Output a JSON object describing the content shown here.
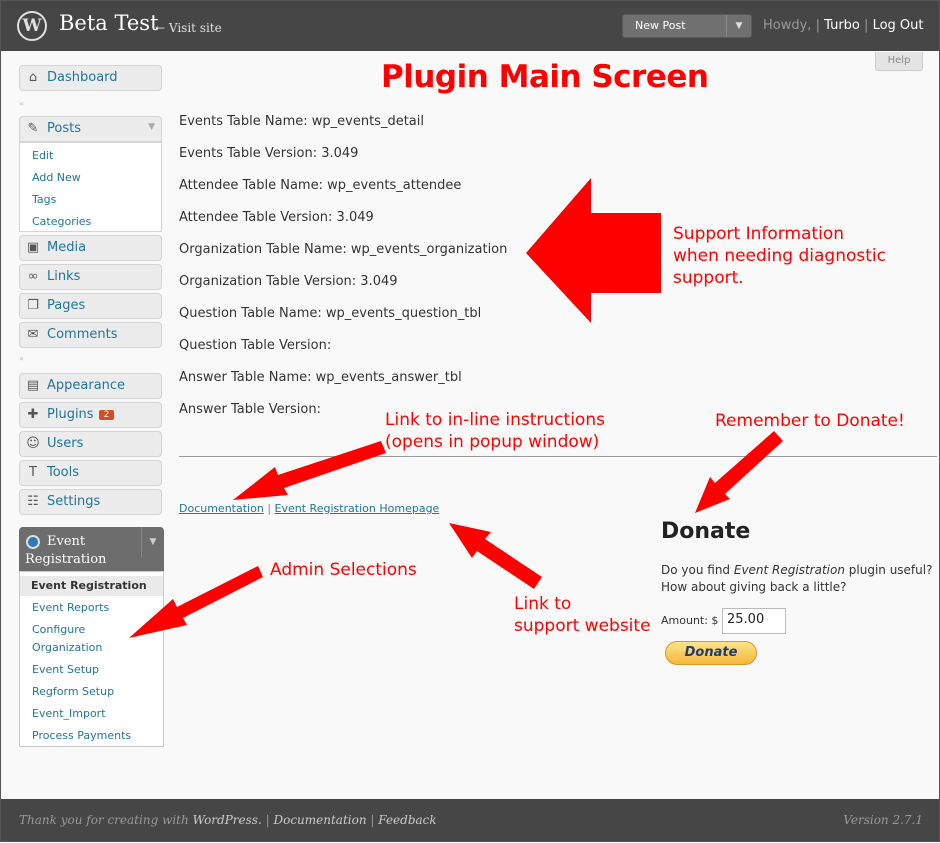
{
  "header": {
    "site_title": "Beta Test",
    "visit_site": "← Visit site",
    "new_post": "New Post",
    "howdy": "Howdy,",
    "separator": "|",
    "user": "Turbo",
    "logout": "Log Out",
    "help": "Help"
  },
  "sidebar": {
    "dashboard": "Dashboard",
    "posts": "Posts",
    "posts_sub": [
      "Edit",
      "Add New",
      "Tags",
      "Categories"
    ],
    "media": "Media",
    "links": "Links",
    "pages": "Pages",
    "comments": "Comments",
    "appearance": "Appearance",
    "plugins": "Plugins",
    "plugins_badge": "2",
    "users": "Users",
    "tools": "Tools",
    "settings": "Settings",
    "event_registration": "Event Registration",
    "event_sub": [
      "Event Registration",
      "Event Reports",
      "Configure",
      "Organization",
      "Event Setup",
      "Regform Setup",
      "Event_Import",
      "Process Payments"
    ]
  },
  "main": {
    "title": "Plugin Main Screen",
    "info": [
      "Events Table Name: wp_events_detail",
      "Events Table Version: 3.049",
      "Attendee Table Name: wp_events_attendee",
      "Attendee Table Version: 3.049",
      "Organization Table Name: wp_events_organization",
      "Organization Table Version: 3.049",
      "Question Table Name: wp_events_question_tbl",
      "Question Table Version:",
      "Answer Table Name: wp_events_answer_tbl",
      "Answer Table Version:"
    ],
    "documentation_link": "Documentation",
    "link_sep": "|",
    "homepage_link": "Event Registration Homepage"
  },
  "annotations": {
    "support": [
      "Support Information",
      "when needing diagnostic",
      "support."
    ],
    "inline": [
      "Link to in-line instructions",
      "(opens in popup window)"
    ],
    "donate": "Remember to Donate!",
    "admin": "Admin Selections",
    "website": [
      "Link to",
      "support website"
    ]
  },
  "donate": {
    "title": "Donate",
    "line1_pre": "Do you find ",
    "line1_em": "Event Registration",
    "line1_post": " plugin useful?",
    "line2": "How about giving back a little?",
    "amount_label": "Amount: $",
    "amount_value": "25.00",
    "button": "Donate"
  },
  "footer": {
    "thanks": "Thank you for creating with",
    "wordpress": "WordPress.",
    "sep": "|",
    "documentation": "Documentation",
    "feedback": "Feedback",
    "version": "Version 2.7.1"
  },
  "colors": {
    "annotation": "#ff0000",
    "link": "#21759b",
    "header": "#464646"
  }
}
